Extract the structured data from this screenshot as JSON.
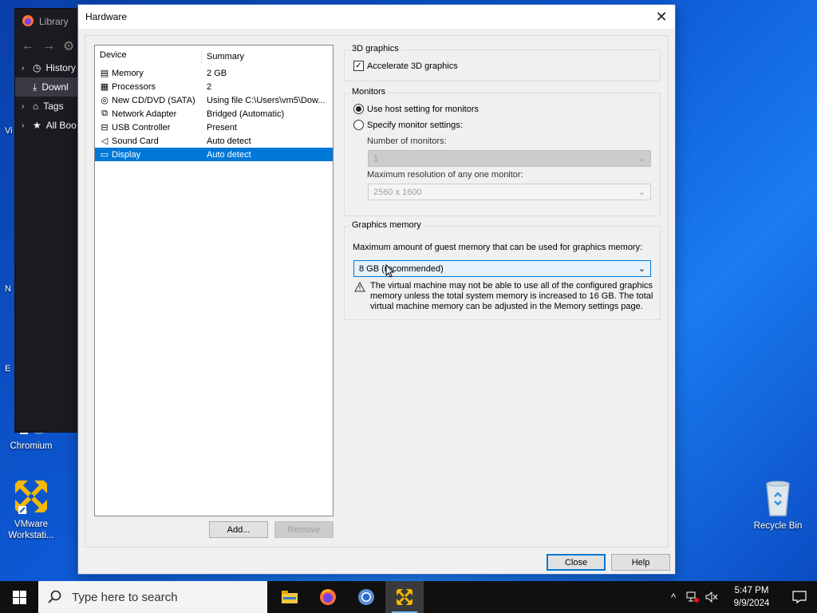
{
  "desktop": {
    "icons": [
      {
        "label": "Chromium"
      },
      {
        "label": "VMware Workstati..."
      },
      {
        "label": "Recycle Bin"
      }
    ],
    "partial_letters": [
      "Vi",
      "N",
      "E"
    ]
  },
  "library": {
    "title": "Library",
    "items": [
      {
        "label": "History"
      },
      {
        "label": "Downl"
      },
      {
        "label": "Tags"
      },
      {
        "label": "All Boo"
      }
    ]
  },
  "dialog": {
    "title": "Hardware",
    "device_list": {
      "headers": [
        "Device",
        "Summary"
      ],
      "rows": [
        {
          "device": "Memory",
          "summary": "2 GB",
          "icon": "memory-icon"
        },
        {
          "device": "Processors",
          "summary": "2",
          "icon": "processor-icon"
        },
        {
          "device": "New CD/DVD (SATA)",
          "summary": "Using file C:\\Users\\vm5\\Dow...",
          "icon": "cd-dvd-icon"
        },
        {
          "device": "Network Adapter",
          "summary": "Bridged (Automatic)",
          "icon": "network-adapter-icon"
        },
        {
          "device": "USB Controller",
          "summary": "Present",
          "icon": "usb-icon"
        },
        {
          "device": "Sound Card",
          "summary": "Auto detect",
          "icon": "sound-icon"
        },
        {
          "device": "Display",
          "summary": "Auto detect",
          "icon": "display-icon"
        }
      ],
      "selected_index": 6
    },
    "add_label": "Add...",
    "remove_label": "Remove",
    "graphics3d": {
      "title": "3D graphics",
      "accelerate_label": "Accelerate 3D graphics",
      "accelerate_checked": true
    },
    "monitors": {
      "title": "Monitors",
      "use_host_label": "Use host setting for monitors",
      "specify_label": "Specify monitor settings:",
      "selected": "use_host",
      "num_monitors_label": "Number of monitors:",
      "num_monitors_value": "1",
      "max_res_label": "Maximum resolution of any one monitor:",
      "max_res_value": "2560 x 1600"
    },
    "graphics_memory": {
      "title": "Graphics memory",
      "desc": "Maximum amount of guest memory that can be used for graphics memory:",
      "value": "8 GB (recommended)",
      "warning_lines": [
        "The virtual machine may not be able to use all of the configured graphics",
        "memory unless the total system memory is increased to 16 GB. The total",
        "virtual machine memory can be adjusted in the Memory settings page."
      ]
    },
    "close_label": "Close",
    "help_label": "Help"
  },
  "taskbar": {
    "search_placeholder": "Type here to search",
    "time": "5:47 PM",
    "date": "9/9/2024"
  },
  "colors": {
    "selection": "#0078d7",
    "taskbar": "#101010",
    "vmware_yellow": "#f5b800"
  }
}
